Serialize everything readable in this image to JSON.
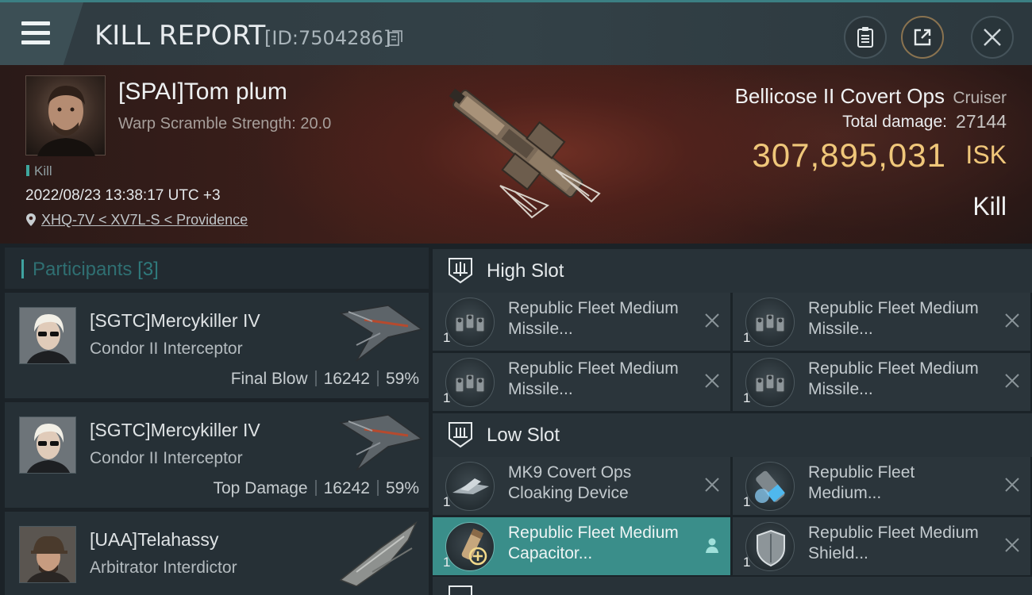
{
  "header": {
    "title": "KILL REPORT",
    "report_id": "[ID:7504286]"
  },
  "victim": {
    "name": "[SPAI]Tom plum",
    "warp_scramble": "Warp Scramble Strength: 20.0",
    "tag": "Kill",
    "datetime": "2022/08/23 13:38:17 UTC +3",
    "location": "XHQ-7V < XV7L-S < Providence",
    "ship_name": "Bellicose II Covert Ops",
    "ship_class": "Cruiser",
    "total_damage_label": "Total damage:",
    "total_damage": "27144",
    "isk_value": "307,895,031",
    "isk_unit": "ISK",
    "result": "Kill"
  },
  "participants": {
    "label": "Participants",
    "count": "[3]",
    "items": [
      {
        "name": "[SGTC]Mercykiller IV",
        "ship": "Condor II Interceptor",
        "role": "Final Blow",
        "damage": "16242",
        "percent": "59%"
      },
      {
        "name": "[SGTC]Mercykiller IV",
        "ship": "Condor II Interceptor",
        "role": "Top Damage",
        "damage": "16242",
        "percent": "59%"
      },
      {
        "name": "[UAA]Telahassy",
        "ship": "Arbitrator Interdictor"
      }
    ]
  },
  "slots": {
    "high": {
      "label": "High Slot",
      "modules": [
        {
          "qty": "1",
          "name": "Republic Fleet Medium Missile..."
        },
        {
          "qty": "1",
          "name": "Republic Fleet Medium Missile..."
        },
        {
          "qty": "1",
          "name": "Republic Fleet Medium Missile..."
        },
        {
          "qty": "1",
          "name": "Republic Fleet Medium Missile..."
        }
      ]
    },
    "low": {
      "label": "Low Slot",
      "modules": [
        {
          "qty": "1",
          "name": "MK9 Covert Ops Cloaking Device"
        },
        {
          "qty": "1",
          "name": "Republic Fleet Medium..."
        },
        {
          "qty": "1",
          "name": "Republic Fleet Medium Capacitor..."
        },
        {
          "qty": "1",
          "name": "Republic Fleet Medium Shield..."
        }
      ]
    }
  },
  "colors": {
    "accent_teal": "#3fa3a0",
    "isk_gold": "#f0c77a",
    "highlight_row": "#3a8e8a"
  }
}
